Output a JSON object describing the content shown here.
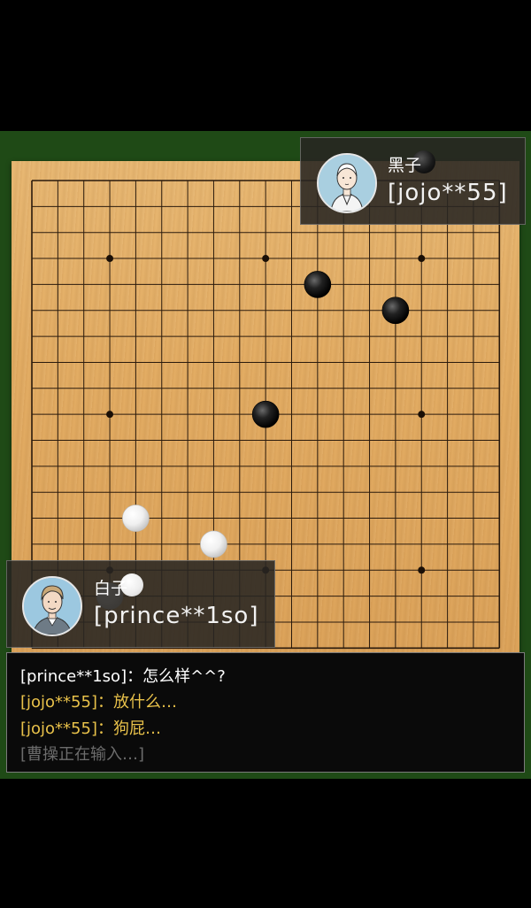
{
  "game": {
    "board_size": 19,
    "star_points": [
      [
        3,
        3
      ],
      [
        3,
        9
      ],
      [
        3,
        15
      ],
      [
        9,
        3
      ],
      [
        9,
        15
      ],
      [
        15,
        3
      ],
      [
        15,
        9
      ],
      [
        15,
        15
      ]
    ],
    "stones": [
      {
        "color": "black",
        "col": 11,
        "row": 4
      },
      {
        "color": "black",
        "col": 14,
        "row": 5
      },
      {
        "color": "black",
        "col": 9,
        "row": 9
      },
      {
        "color": "white",
        "col": 4,
        "row": 13
      },
      {
        "color": "white",
        "col": 7,
        "row": 14
      },
      {
        "color": "white",
        "col": 3,
        "row": 16
      }
    ]
  },
  "players": {
    "black": {
      "color_label": "黑子",
      "name": "[jojo**55]",
      "avatar": "woman-portrait-avatar"
    },
    "white": {
      "color_label": "白子",
      "name": "[prince**1so]",
      "avatar": "man-portrait-avatar"
    }
  },
  "chat": {
    "lines": [
      {
        "text": "[prince**1so]：怎么样^^?",
        "color": "#ffffff"
      },
      {
        "text": "[jojo**55]：放什么…",
        "color": "#e8c14a"
      },
      {
        "text": "[jojo**55]：狗屁…",
        "color": "#e8c14a"
      },
      {
        "text": "[曹操正在输入…]",
        "color": "#6c6c6c"
      }
    ]
  }
}
